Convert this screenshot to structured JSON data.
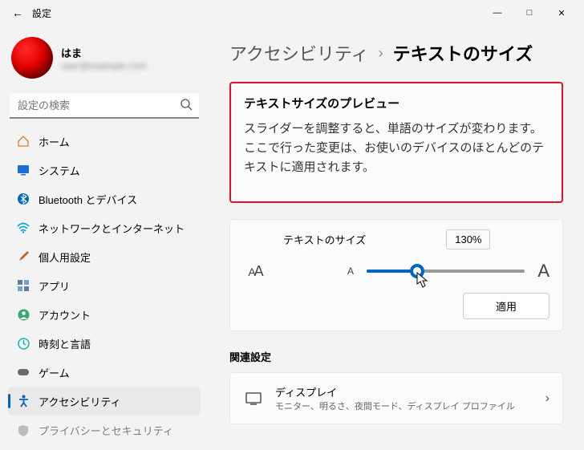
{
  "window": {
    "title": "設定"
  },
  "user": {
    "name": "はま",
    "email": "user@example.com"
  },
  "search": {
    "placeholder": "設定の検索"
  },
  "nav": {
    "items": [
      {
        "label": "ホーム",
        "icon": "home"
      },
      {
        "label": "システム",
        "icon": "system"
      },
      {
        "label": "Bluetooth とデバイス",
        "icon": "bluetooth"
      },
      {
        "label": "ネットワークとインターネット",
        "icon": "network"
      },
      {
        "label": "個人用設定",
        "icon": "personalize"
      },
      {
        "label": "アプリ",
        "icon": "apps"
      },
      {
        "label": "アカウント",
        "icon": "account"
      },
      {
        "label": "時刻と言語",
        "icon": "time"
      },
      {
        "label": "ゲーム",
        "icon": "game"
      },
      {
        "label": "アクセシビリティ",
        "icon": "accessibility"
      },
      {
        "label": "プライバシーとセキュリティ",
        "icon": "privacy"
      }
    ]
  },
  "breadcrumb": {
    "parent": "アクセシビリティ",
    "current": "テキストのサイズ"
  },
  "preview": {
    "heading": "テキストサイズのプレビュー",
    "body": "スライダーを調整すると、単語のサイズが変わります。ここで行った変更は、お使いのデバイスのほとんどのテキストに適用されます。"
  },
  "slider": {
    "label": "テキストのサイズ",
    "value_pct": "130%",
    "fill_pct": 32,
    "apply_label": "適用"
  },
  "related": {
    "section": "関連設定",
    "items": [
      {
        "title": "ディスプレイ",
        "subtitle": "モニター、明るさ、夜間モード、ディスプレイ プロファイル"
      }
    ]
  }
}
